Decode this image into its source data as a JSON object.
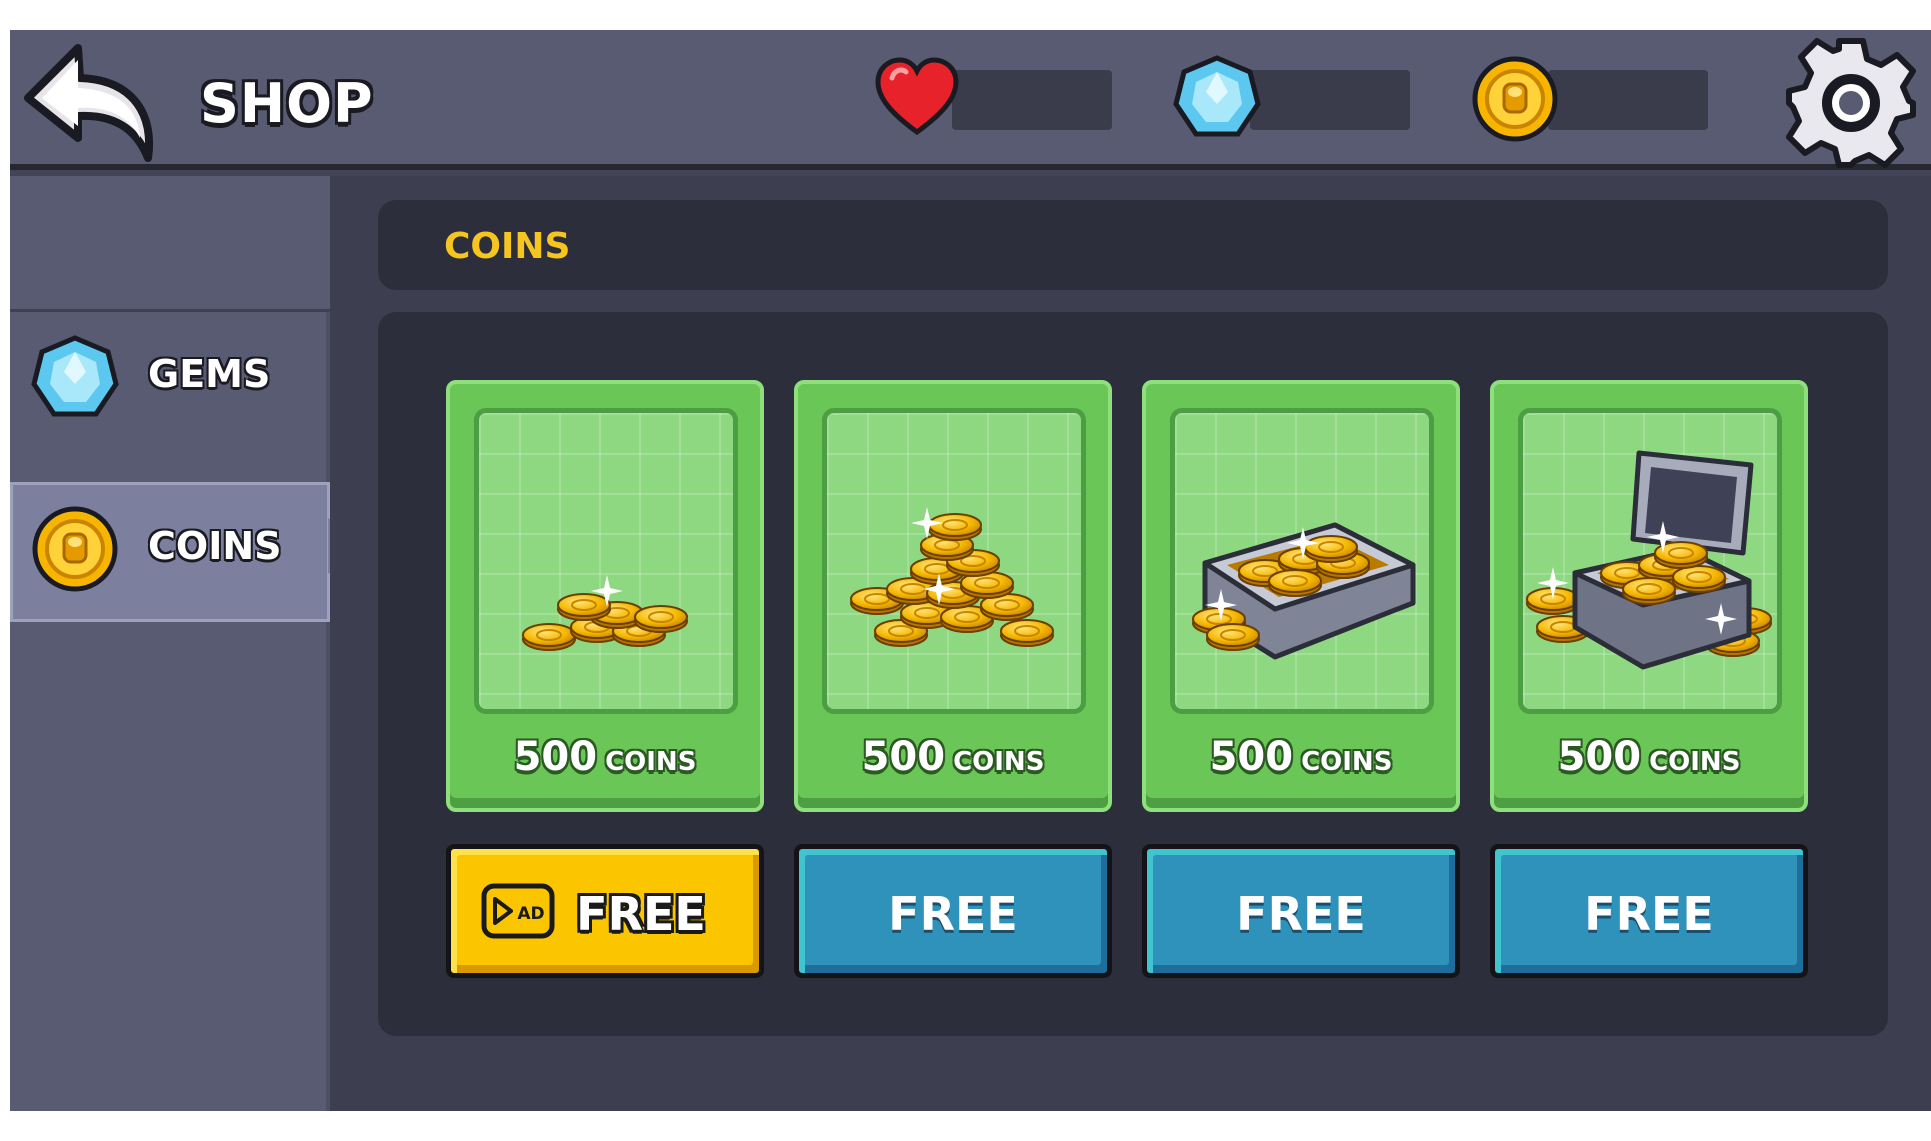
{
  "header": {
    "title": "SHOP",
    "resources": [
      {
        "name": "lives",
        "icon": "heart-icon",
        "value": "",
        "color": "#e8222a"
      },
      {
        "name": "gems",
        "icon": "gem-icon",
        "value": "",
        "color": "#5cc8f0"
      },
      {
        "name": "coins",
        "icon": "coin-icon",
        "value": "",
        "color": "#f7b500"
      }
    ]
  },
  "sidebar": {
    "items": [
      {
        "label": "GEMS",
        "icon": "gem-icon",
        "active": false
      },
      {
        "label": "COINS",
        "icon": "coin-icon",
        "active": true
      }
    ]
  },
  "section": {
    "title": "COINS"
  },
  "offers": [
    {
      "amount": "500",
      "unit": "COINS",
      "art": "small-coin-pile-icon",
      "button": "FREE",
      "button_style": "ad"
    },
    {
      "amount": "500",
      "unit": "COINS",
      "art": "coin-pile-icon",
      "button": "FREE",
      "button_style": "plain"
    },
    {
      "amount": "500",
      "unit": "COINS",
      "art": "coin-tray-icon",
      "button": "FREE",
      "button_style": "plain"
    },
    {
      "amount": "500",
      "unit": "COINS",
      "art": "treasure-chest-icon",
      "button": "FREE",
      "button_style": "plain"
    }
  ],
  "colors": {
    "accent": "#f7c520",
    "card_green": "#6ac757",
    "button_blue": "#2f92bb",
    "button_yellow": "#fbc600"
  }
}
